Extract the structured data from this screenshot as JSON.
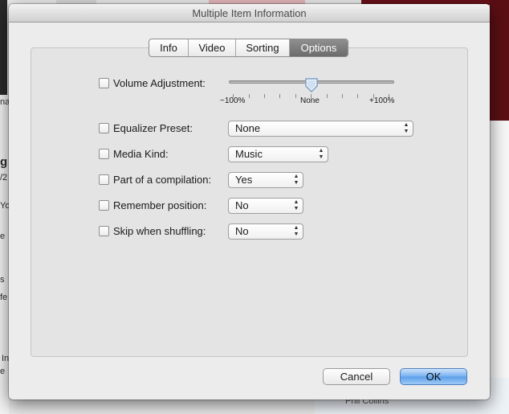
{
  "background": {
    "fragments": [
      "na",
      "g",
      "/2",
      "Yo",
      "e",
      "s",
      "fe",
      "In",
      "e"
    ],
    "footer_text": "Phil Collins"
  },
  "dialog": {
    "title": "Multiple Item Information",
    "tabs": [
      {
        "label": "Info",
        "active": false
      },
      {
        "label": "Video",
        "active": false
      },
      {
        "label": "Sorting",
        "active": false
      },
      {
        "label": "Options",
        "active": true
      }
    ]
  },
  "options": {
    "volume_adjustment": {
      "label": "Volume Adjustment:",
      "checked": false,
      "min_label": "−100%",
      "mid_label": "None",
      "max_label": "+100%",
      "value_percent": 0
    },
    "equalizer_preset": {
      "label": "Equalizer Preset:",
      "checked": false,
      "value": "None"
    },
    "media_kind": {
      "label": "Media Kind:",
      "checked": false,
      "value": "Music"
    },
    "part_of_compilation": {
      "label": "Part of a compilation:",
      "checked": false,
      "value": "Yes"
    },
    "remember_position": {
      "label": "Remember position:",
      "checked": false,
      "value": "No"
    },
    "skip_when_shuffling": {
      "label": "Skip when shuffling:",
      "checked": false,
      "value": "No"
    }
  },
  "buttons": {
    "cancel_label": "Cancel",
    "ok_label": "OK"
  },
  "colors": {
    "accent": "#5b9ee9",
    "tab_active": "#7d7d7d"
  },
  "icons": {
    "popup_arrows": "up-down-chevron-icon",
    "slider_knob": "slider-knob-icon"
  }
}
